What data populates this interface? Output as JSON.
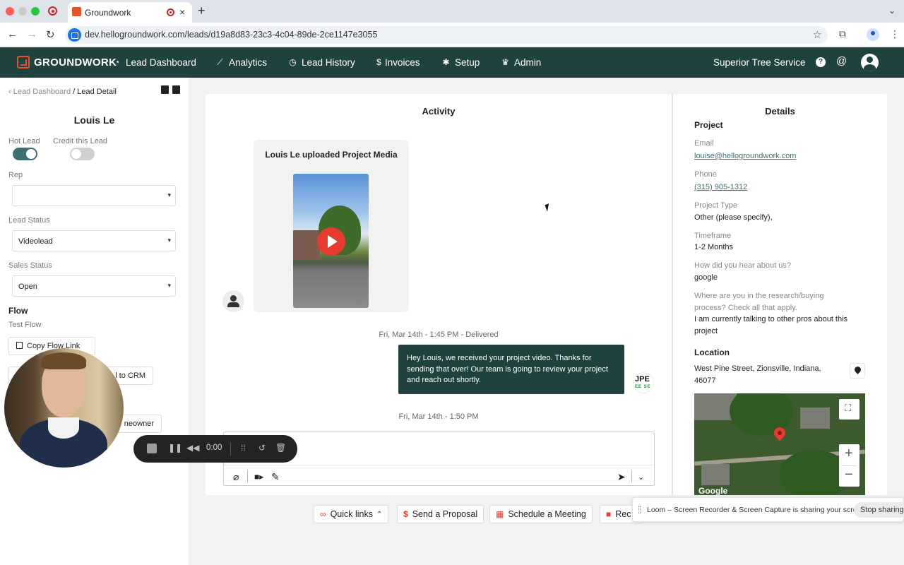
{
  "browser": {
    "tab_title": "Groundwork",
    "url": "dev.hellogroundwork.com/leads/d19a8d83-23c3-4c04-89de-2ce1147e3055"
  },
  "nav": {
    "brand": "GROUNDWORK",
    "items": [
      {
        "label": "Lead Dashboard",
        "icon": "dashboard-icon"
      },
      {
        "label": "Analytics",
        "icon": "chart-icon"
      },
      {
        "label": "Lead History",
        "icon": "clock-icon"
      },
      {
        "label": "Invoices",
        "icon": "dollar-icon"
      },
      {
        "label": "Setup",
        "icon": "gear-icon"
      },
      {
        "label": "Admin",
        "icon": "crown-icon"
      }
    ],
    "company": "Superior Tree Service"
  },
  "sidebar": {
    "breadcrumb_parent": "Lead Dashboard",
    "breadcrumb_current": "/ Lead Detail",
    "lead_name": "Louis Le",
    "hot_lead_label": "Hot Lead",
    "hot_lead_on": true,
    "credit_label": "Credit this Lead",
    "credit_on": false,
    "rep_label": "Rep",
    "rep_value": "",
    "lead_status_label": "Lead Status",
    "lead_status_value": "Videolead",
    "sales_status_label": "Sales Status",
    "sales_status_value": "Open",
    "flow_title": "Flow",
    "flow_name": "Test Flow",
    "copy_flow_link": "Copy Flow Link",
    "send_crm_partial": "l to CRM",
    "homeowner_partial": "neowner"
  },
  "activity": {
    "title": "Activity",
    "media_title": "Louis Le uploaded Project Media",
    "ts1": "Fri, Mar 14th - 1:45 PM - Delivered",
    "message": "Hey Louis, we received your project video. Thanks for sending that over! Our team is going to review your project and reach out shortly.",
    "ts2": "Fri, Mar 14th - 1:50 PM",
    "company_avatar_top": "JPE",
    "company_avatar_bottom": "EE SE"
  },
  "details": {
    "title": "Details",
    "project_title": "Project",
    "email_label": "Email",
    "email": "louise@hellogroundwork.com",
    "phone_label": "Phone",
    "phone": "(315) 905-1312",
    "project_type_label": "Project Type",
    "project_type": "Other (please specify),",
    "timeframe_label": "Timeframe",
    "timeframe": "1-2 Months",
    "hear_label": "How did you hear about us?",
    "hear": "google",
    "research_label_1": "Where are you in the research/buying",
    "research_label_2": "process? Check all that apply.",
    "research_1": "I am currently talking to other pros about this",
    "research_2": "project",
    "location_title": "Location",
    "address_1": "West Pine Street, Zionsville, Indiana,",
    "address_2": "46077",
    "map_attribution": "Google"
  },
  "actions": {
    "quick_links": "Quick links",
    "send_proposal": "Send a Proposal",
    "schedule_meeting": "Schedule a Meeting",
    "record_partial": "Rec"
  },
  "loom": {
    "share_message": "Loom – Screen Recorder & Screen Capture is sharing your screen.",
    "stop_sharing": "Stop sharing",
    "timer": "0:00"
  },
  "colors": {
    "brand_dark": "#20423f",
    "brand_accent": "#e4532c",
    "toggle_on": "#3f6f73"
  }
}
